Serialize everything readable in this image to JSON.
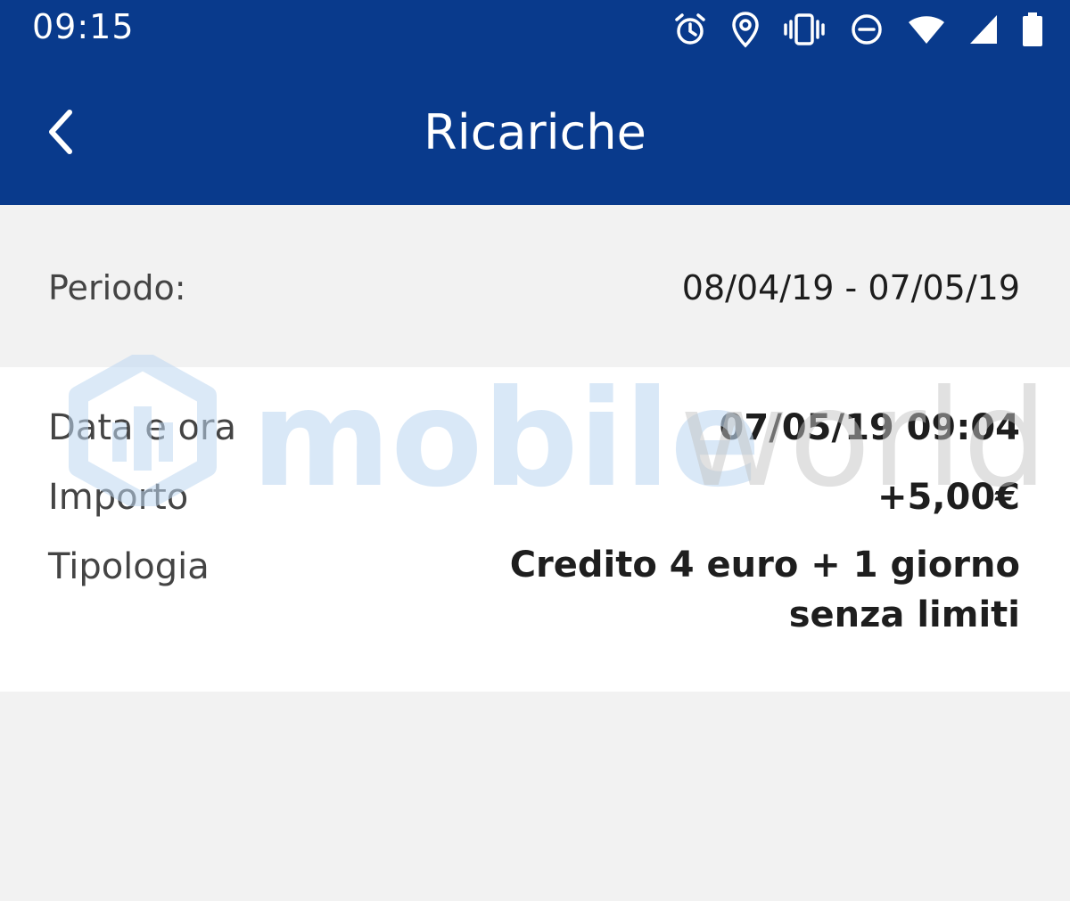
{
  "status_bar": {
    "time": "09:15",
    "icons": [
      "alarm-icon",
      "location-icon",
      "vibrate-icon",
      "do-not-disturb-icon",
      "wifi-icon",
      "signal-icon",
      "battery-icon"
    ]
  },
  "app_bar": {
    "title": "Ricariche",
    "back_icon": "chevron-left-icon"
  },
  "period": {
    "label": "Periodo:",
    "value": "08/04/19 - 07/05/19"
  },
  "recharge": {
    "date_label": "Data e ora",
    "date_value": "07/05/19 09:04",
    "amount_label": "Importo",
    "amount_value": "+5,00€",
    "type_label": "Tipologia",
    "type_value": "Credito 4 euro + 1 giorno senza limiti"
  },
  "watermark": {
    "brand_primary": "mobile",
    "brand_secondary": "world"
  },
  "colors": {
    "header": "#093a8c",
    "background": "#f2f2f2",
    "card": "#ffffff",
    "watermark_blue": "#bfd8f2",
    "watermark_gray": "#c4c4c4"
  }
}
